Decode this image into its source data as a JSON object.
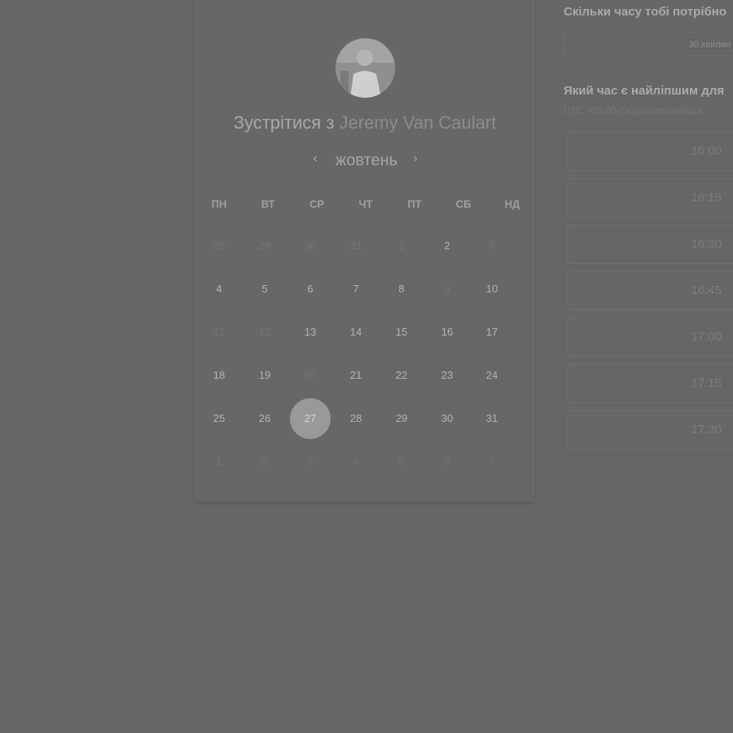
{
  "meeting": {
    "title_prefix": "Зустрітися з",
    "host_name": "Jeremy Van Caulart"
  },
  "calendar": {
    "month_label": "жовтень",
    "prev_icon": "‹",
    "next_icon": "›",
    "weekdays": [
      "ПН",
      "ВТ",
      "СР",
      "ЧТ",
      "ПТ",
      "СБ",
      "НД"
    ],
    "weeks": [
      [
        {
          "n": "28",
          "s": "muted"
        },
        {
          "n": "29",
          "s": "muted"
        },
        {
          "n": "30",
          "s": "muted"
        },
        {
          "n": "31",
          "s": "muted"
        },
        {
          "n": "1",
          "s": "muted"
        },
        {
          "n": "2",
          "s": "avail"
        },
        {
          "n": "3",
          "s": "muted"
        }
      ],
      [
        {
          "n": "4",
          "s": "avail"
        },
        {
          "n": "5",
          "s": "avail"
        },
        {
          "n": "6",
          "s": "avail"
        },
        {
          "n": "7",
          "s": "avail"
        },
        {
          "n": "8",
          "s": "avail"
        },
        {
          "n": "9",
          "s": "muted"
        },
        {
          "n": "10",
          "s": "avail"
        }
      ],
      [
        {
          "n": "11",
          "s": "muted"
        },
        {
          "n": "12",
          "s": "muted"
        },
        {
          "n": "13",
          "s": "avail"
        },
        {
          "n": "14",
          "s": "avail"
        },
        {
          "n": "15",
          "s": "avail"
        },
        {
          "n": "16",
          "s": "avail"
        },
        {
          "n": "17",
          "s": "avail"
        }
      ],
      [
        {
          "n": "18",
          "s": "avail"
        },
        {
          "n": "19",
          "s": "avail"
        },
        {
          "n": "20",
          "s": "muted"
        },
        {
          "n": "21",
          "s": "avail"
        },
        {
          "n": "22",
          "s": "avail"
        },
        {
          "n": "23",
          "s": "avail"
        },
        {
          "n": "24",
          "s": "avail"
        }
      ],
      [
        {
          "n": "25",
          "s": "avail"
        },
        {
          "n": "26",
          "s": "avail"
        },
        {
          "n": "27",
          "s": "selected"
        },
        {
          "n": "28",
          "s": "avail"
        },
        {
          "n": "29",
          "s": "avail"
        },
        {
          "n": "30",
          "s": "avail"
        },
        {
          "n": "31",
          "s": "avail"
        }
      ],
      [
        {
          "n": "1",
          "s": "muted"
        },
        {
          "n": "2",
          "s": "muted"
        },
        {
          "n": "3",
          "s": "muted"
        },
        {
          "n": "4",
          "s": "muted"
        },
        {
          "n": "5",
          "s": "muted"
        },
        {
          "n": "6",
          "s": "muted"
        },
        {
          "n": "7",
          "s": "muted"
        }
      ]
    ]
  },
  "duration": {
    "question": "Скільки часу тобі потрібно",
    "value": "30 хвилин"
  },
  "time": {
    "question": "Який час є найліпшим для",
    "timezone": "UTC +03:00 Східноєвропейськ",
    "slots": [
      "16:00",
      "16:15",
      "16:30",
      "16:45",
      "17:00",
      "17:15",
      "17:30"
    ]
  },
  "colors": {
    "overlay_background": "#666666",
    "selected_day": "#999999"
  }
}
